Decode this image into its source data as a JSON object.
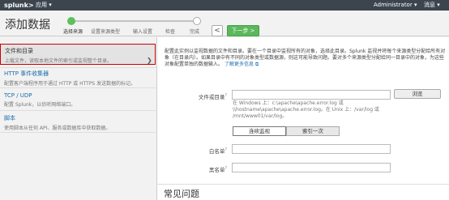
{
  "topbar": {
    "logo": "splunk>",
    "app_menu": "应用 ▾",
    "user_menu": "Administrator ▾",
    "messages": "消息 ▾"
  },
  "header": {
    "title": "添加数据",
    "steps": [
      {
        "label": "选择来源",
        "active": true
      },
      {
        "label": "设置来源类型",
        "active": false
      },
      {
        "label": "输入设置",
        "active": false
      },
      {
        "label": "检查",
        "active": false
      },
      {
        "label": "完成",
        "active": false
      }
    ],
    "back_label": "<",
    "next_label": "下一步 >"
  },
  "sources": [
    {
      "title": "文件和目录",
      "desc": "上载文件，读取本地文件的索引或监视整个目录。",
      "selected": true
    },
    {
      "title": "HTTP 事件收集器",
      "desc": "配置客户端程序用于通过 HTTP 或 HTTPS 发送数据的标记。",
      "selected": false
    },
    {
      "title": "TCP / UDP",
      "desc": "配置 Splunk，以侦听网络端口。",
      "selected": false
    },
    {
      "title": "脚本",
      "desc": "使用脚本从任何 API、服务或数据库中获取数据。",
      "selected": false
    }
  ],
  "main": {
    "intro": "配置此实例以监视数据的文件和目录。要在一个目录中监视所有的对象，选择此目录。Splunk 监视并将每个来源类型分配给所有对象（在目录内）。如果目录中有不同的对象类型或数据源，则这可能导致问题。要对多个来源类型分配给同一目录中的对象，为这些对象配置单独的数据输入。",
    "learn_more": "了解更多信息 ⧉",
    "file_label": "文件或目录",
    "file_value": "",
    "browse_label": "浏览",
    "hint": "在 Windows 上：c:\\apache\\apache.error.log 或 \\\\hostname\\apache\\apache.error.log。在 Unix 上：/var/log 或 /mnt/www01/var/log。",
    "mode_on": "连续监视",
    "mode_off": "索引一次",
    "whitelist_label": "白名单",
    "whitelist_value": "",
    "blacklist_label": "黑名单",
    "blacklist_value": "",
    "faq_title": "常见问题"
  },
  "colors": {
    "topbar": "#3c444d",
    "accent_green": "#5cb85c",
    "link_blue": "#1a6dad",
    "selection_border": "#cc0000"
  }
}
